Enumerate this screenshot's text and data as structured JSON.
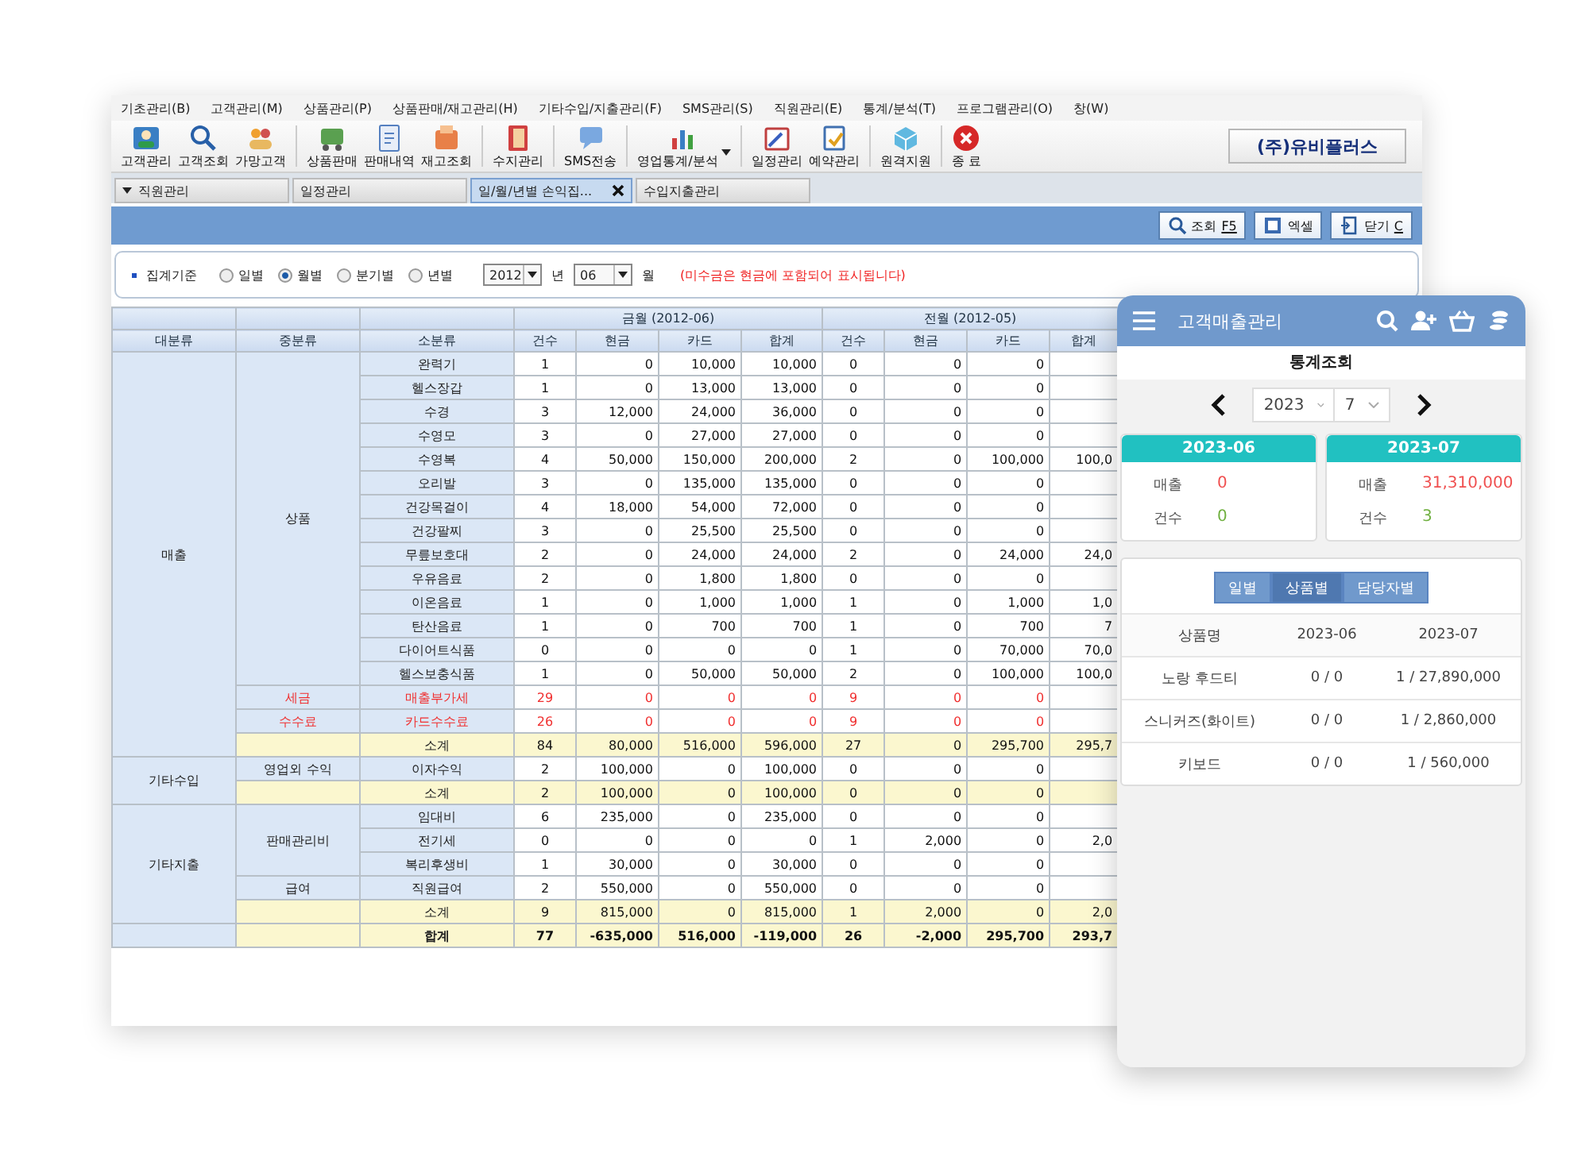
{
  "menu": [
    "기초관리(B)",
    "고객관리(M)",
    "상품관리(P)",
    "상품판매/재고관리(H)",
    "기타수입/지출관리(F)",
    "SMS관리(S)",
    "직원관리(E)",
    "통계/분석(T)",
    "프로그램관리(O)",
    "창(W)"
  ],
  "toolbar": [
    {
      "label": "고객관리"
    },
    {
      "label": "고객조회"
    },
    {
      "label": "가망고객"
    },
    {
      "label": "상품판매"
    },
    {
      "label": "판매내역"
    },
    {
      "label": "재고조회"
    },
    {
      "label": "수지관리"
    },
    {
      "label": "SMS전송"
    },
    {
      "label": "영업통계/분석",
      "dropdown": true
    },
    {
      "label": "일정관리"
    },
    {
      "label": "예약관리"
    },
    {
      "label": "원격지원"
    },
    {
      "label": "종 료"
    }
  ],
  "company_button": "(주)유비플러스",
  "tabs": [
    {
      "label": "직원관리",
      "selected": false,
      "menu": true
    },
    {
      "label": "일정관리",
      "selected": false
    },
    {
      "label": "일/월/년별 손익집...",
      "selected": true,
      "closable": true
    },
    {
      "label": "수입지출관리",
      "selected": false
    }
  ],
  "actions": [
    {
      "label": "조회",
      "shortcut": "F5"
    },
    {
      "label": "엑셀"
    },
    {
      "label": "닫기",
      "shortcut": "C"
    }
  ],
  "filter": {
    "label": "집계기준",
    "options": [
      {
        "label": "일별",
        "selected": false
      },
      {
        "label": "월별",
        "selected": true
      },
      {
        "label": "분기별",
        "selected": false
      },
      {
        "label": "년별",
        "selected": false
      }
    ],
    "year": "2012",
    "year_unit": "년",
    "month": "06",
    "month_unit": "월",
    "note": "(미수금은 현금에 포함되어 표시됩니다)"
  },
  "table": {
    "columns": [
      "대분류",
      "중분류",
      "소분류"
    ],
    "periods": [
      {
        "title": "금월 (2012-06)",
        "columns": [
          "건수",
          "현금",
          "카드",
          "합계"
        ]
      },
      {
        "title": "전월 (2012-05)",
        "columns": [
          "건수",
          "현금",
          "카드",
          "합계"
        ]
      }
    ],
    "groups": [
      {
        "name": "매출",
        "subgroups": [
          {
            "name": "상품",
            "kind": "normal",
            "items": [
              {
                "name": "완력기",
                "values": [
                  "1",
                  "0",
                  "10,000",
                  "10,000",
                  "0",
                  "0",
                  "0"
                ]
              },
              {
                "name": "헬스장갑",
                "values": [
                  "1",
                  "0",
                  "13,000",
                  "13,000",
                  "0",
                  "0",
                  "0"
                ]
              },
              {
                "name": "수경",
                "values": [
                  "3",
                  "12,000",
                  "24,000",
                  "36,000",
                  "0",
                  "0",
                  "0"
                ]
              },
              {
                "name": "수영모",
                "values": [
                  "3",
                  "0",
                  "27,000",
                  "27,000",
                  "0",
                  "0",
                  "0"
                ]
              },
              {
                "name": "수영복",
                "values": [
                  "4",
                  "50,000",
                  "150,000",
                  "200,000",
                  "2",
                  "0",
                  "100,000",
                  "100,0"
                ]
              },
              {
                "name": "오리발",
                "values": [
                  "3",
                  "0",
                  "135,000",
                  "135,000",
                  "0",
                  "0",
                  "0"
                ]
              },
              {
                "name": "건강목걸이",
                "values": [
                  "4",
                  "18,000",
                  "54,000",
                  "72,000",
                  "0",
                  "0",
                  "0"
                ]
              },
              {
                "name": "건강팔찌",
                "values": [
                  "3",
                  "0",
                  "25,500",
                  "25,500",
                  "0",
                  "0",
                  "0"
                ]
              },
              {
                "name": "무릎보호대",
                "values": [
                  "2",
                  "0",
                  "24,000",
                  "24,000",
                  "2",
                  "0",
                  "24,000",
                  "24,0"
                ]
              },
              {
                "name": "우유음료",
                "values": [
                  "2",
                  "0",
                  "1,800",
                  "1,800",
                  "0",
                  "0",
                  "0"
                ]
              },
              {
                "name": "이온음료",
                "values": [
                  "1",
                  "0",
                  "1,000",
                  "1,000",
                  "1",
                  "0",
                  "1,000",
                  "1,0"
                ]
              },
              {
                "name": "탄산음료",
                "values": [
                  "1",
                  "0",
                  "700",
                  "700",
                  "1",
                  "0",
                  "700",
                  "7"
                ]
              },
              {
                "name": "다이어트식품",
                "values": [
                  "0",
                  "0",
                  "0",
                  "0",
                  "1",
                  "0",
                  "70,000",
                  "70,0"
                ]
              },
              {
                "name": "헬스보충식품",
                "values": [
                  "1",
                  "0",
                  "50,000",
                  "50,000",
                  "2",
                  "0",
                  "100,000",
                  "100,0"
                ]
              }
            ]
          },
          {
            "name": "세금",
            "kind": "alert",
            "items": [
              {
                "name": "매출부가세",
                "values": [
                  "29",
                  "0",
                  "0",
                  "0",
                  "9",
                  "0",
                  "0"
                ]
              }
            ]
          },
          {
            "name": "수수료",
            "kind": "alert",
            "items": [
              {
                "name": "카드수수료",
                "values": [
                  "26",
                  "0",
                  "0",
                  "0",
                  "9",
                  "0",
                  "0"
                ]
              }
            ]
          }
        ],
        "subtotal": {
          "label": "소계",
          "values": [
            "84",
            "80,000",
            "516,000",
            "596,000",
            "27",
            "0",
            "295,700",
            "295,7"
          ]
        }
      },
      {
        "name": "기타수입",
        "subgroups": [
          {
            "name": "영업외 수익",
            "kind": "normal",
            "items": [
              {
                "name": "이자수익",
                "values": [
                  "2",
                  "100,000",
                  "0",
                  "100,000",
                  "0",
                  "0",
                  "0"
                ]
              }
            ]
          }
        ],
        "subtotal": {
          "label": "소계",
          "values": [
            "2",
            "100,000",
            "0",
            "100,000",
            "0",
            "0",
            "0"
          ]
        }
      },
      {
        "name": "기타지출",
        "subgroups": [
          {
            "name": "판매관리비",
            "kind": "normal",
            "items": [
              {
                "name": "임대비",
                "values": [
                  "6",
                  "235,000",
                  "0",
                  "235,000",
                  "0",
                  "0",
                  "0"
                ]
              },
              {
                "name": "전기세",
                "values": [
                  "0",
                  "0",
                  "0",
                  "0",
                  "1",
                  "2,000",
                  "0",
                  "2,0"
                ]
              },
              {
                "name": "복리후생비",
                "values": [
                  "1",
                  "30,000",
                  "0",
                  "30,000",
                  "0",
                  "0",
                  "0"
                ]
              }
            ]
          },
          {
            "name": "급여",
            "kind": "normal",
            "items": [
              {
                "name": "직원급여",
                "values": [
                  "2",
                  "550,000",
                  "0",
                  "550,000",
                  "0",
                  "0",
                  "0"
                ]
              }
            ]
          }
        ],
        "subtotal": {
          "label": "소계",
          "values": [
            "9",
            "815,000",
            "0",
            "815,000",
            "1",
            "2,000",
            "0",
            "2,0"
          ]
        }
      }
    ],
    "total": {
      "label": "합계",
      "values": [
        "77",
        "-635,000",
        "516,000",
        "-119,000",
        "26",
        "-2,000",
        "295,700",
        "293,7"
      ]
    }
  },
  "mobile": {
    "title": "고객매출관리",
    "subtitle": "통계조회",
    "year": "2023",
    "month": "7",
    "cards": [
      {
        "period": "2023-06",
        "sales_label": "매출",
        "sales": "0",
        "count_label": "건수",
        "count": "0"
      },
      {
        "period": "2023-07",
        "sales_label": "매출",
        "sales": "31,310,000",
        "count_label": "건수",
        "count": "3"
      }
    ],
    "segments": [
      {
        "label": "일별",
        "selected": false
      },
      {
        "label": "상품별",
        "selected": true
      },
      {
        "label": "담당자별",
        "selected": false
      }
    ],
    "columns": [
      "상품명",
      "2023-06",
      "2023-07"
    ],
    "rows": [
      [
        "노랑 후드티",
        "0 / 0",
        "1 / 27,890,000"
      ],
      [
        "스니커즈(화이트)",
        "0 / 0",
        "1 / 2,860,000"
      ],
      [
        "키보드",
        "0 / 0",
        "1 / 560,000"
      ]
    ]
  }
}
